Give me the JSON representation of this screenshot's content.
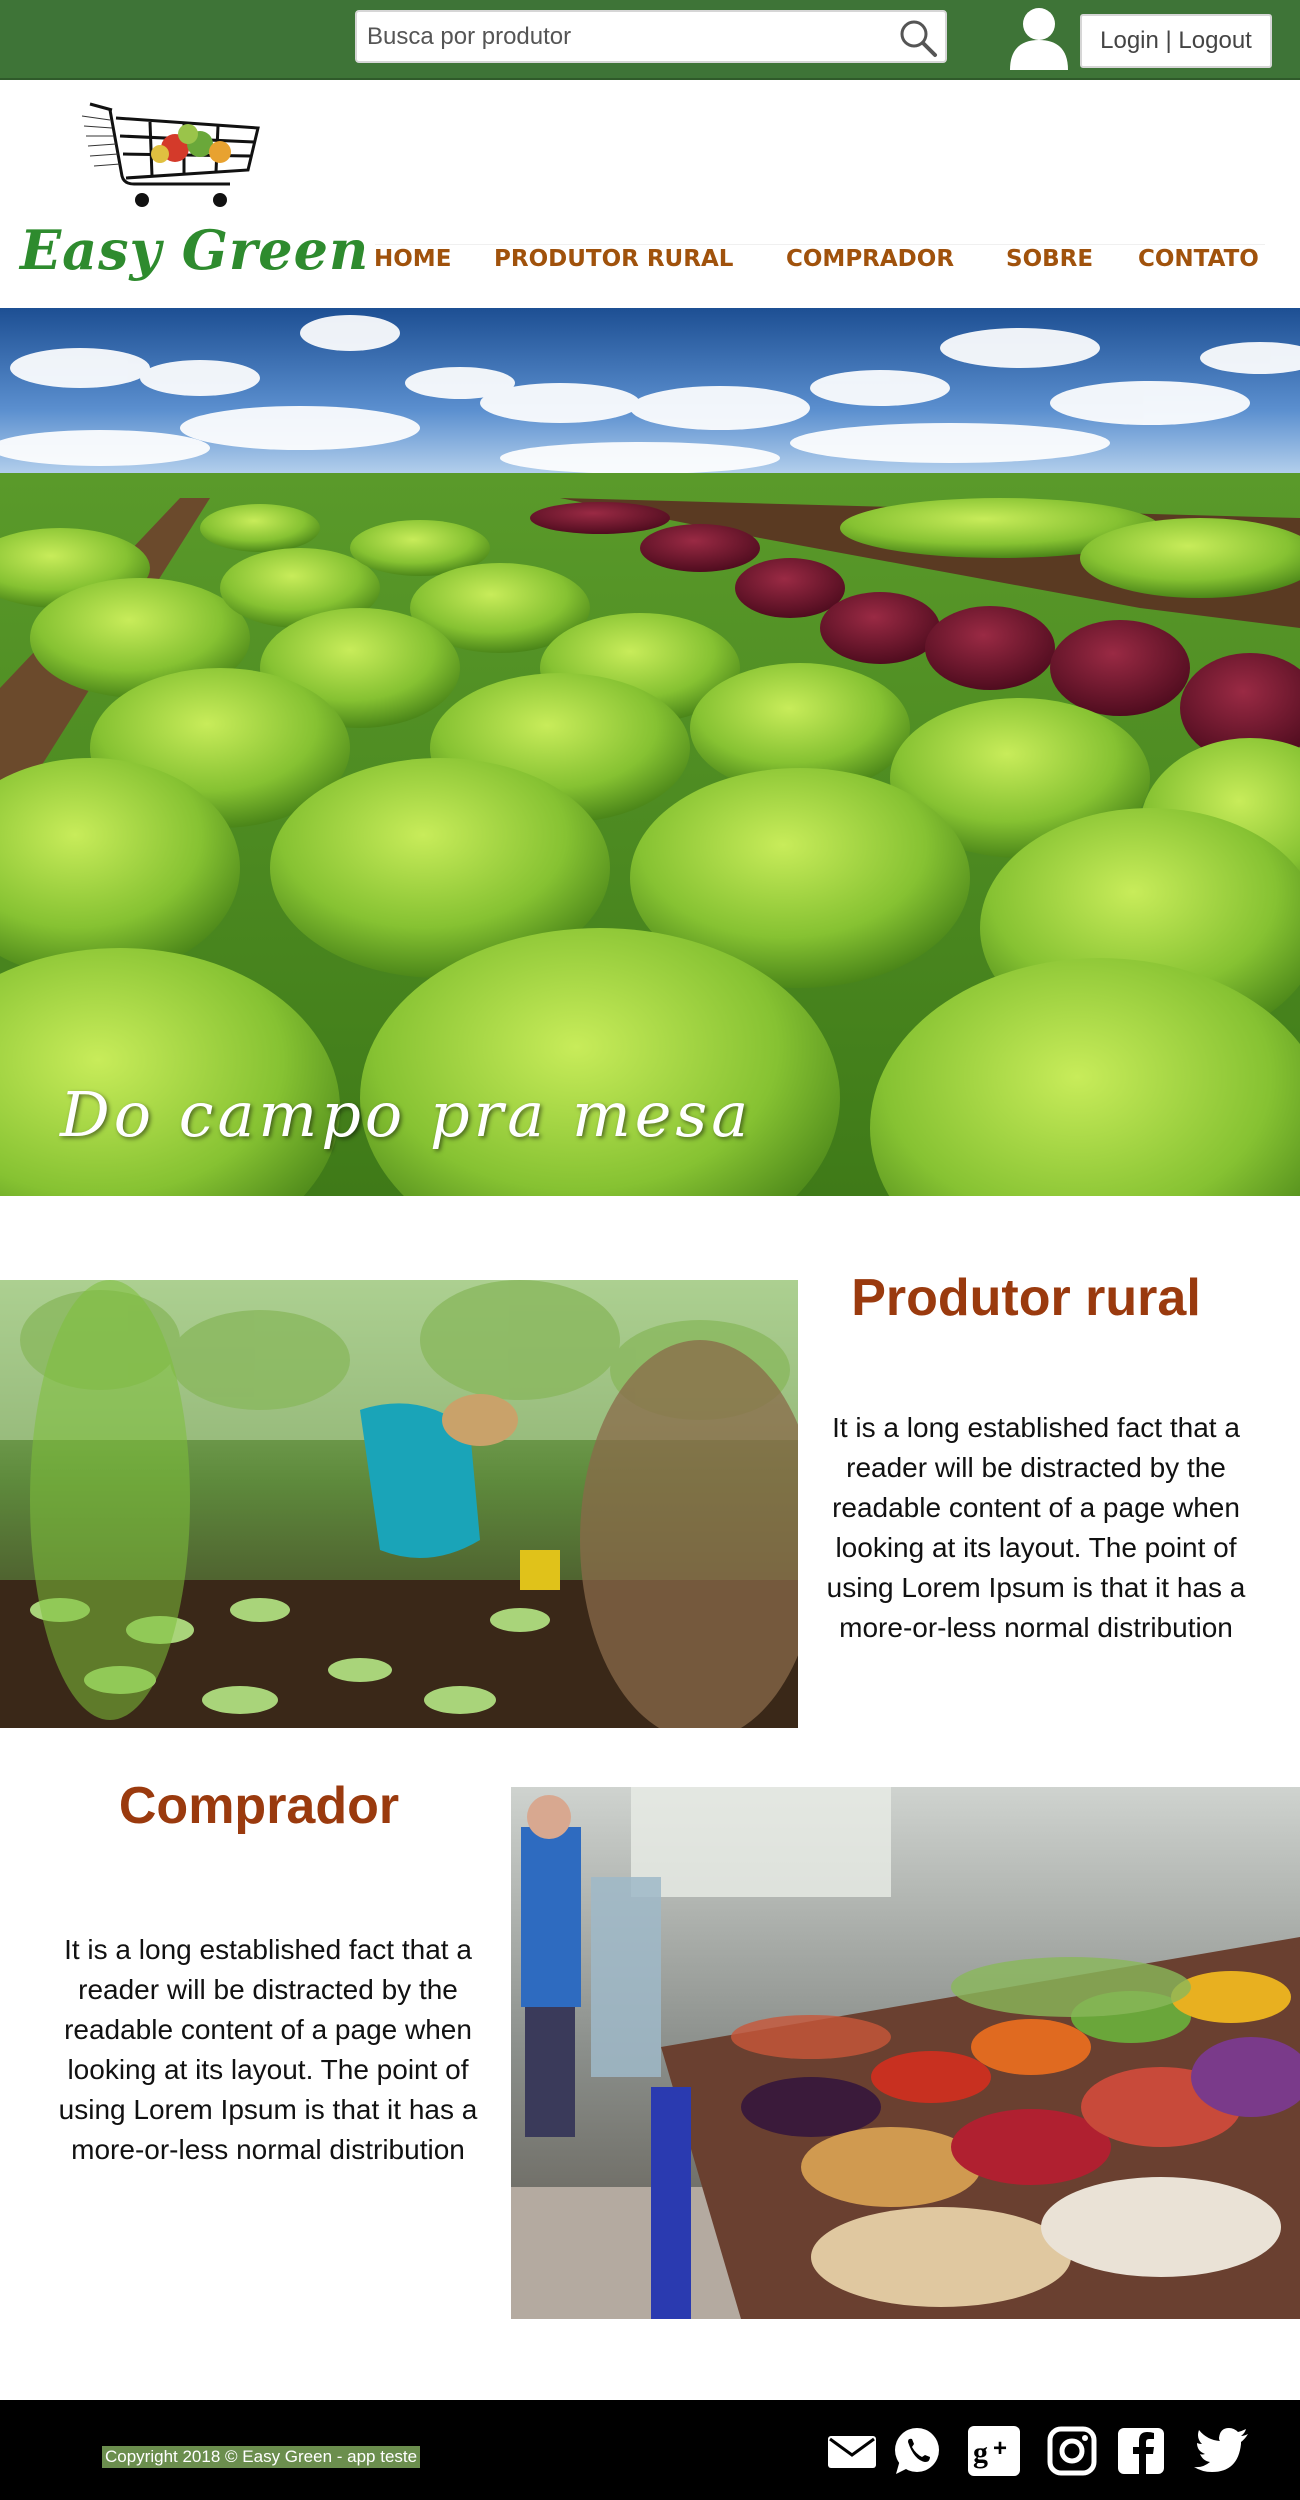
{
  "topbar": {
    "search_placeholder": "Busca por produtor",
    "login_label": "Login | Logout"
  },
  "brand": {
    "name": "Easy Green"
  },
  "nav": {
    "items": [
      "HOME",
      "PRODUTOR RURAL",
      "COMPRADOR",
      "SOBRE",
      "CONTATO"
    ]
  },
  "hero": {
    "caption": "Do campo pra mesa"
  },
  "produtor": {
    "title": "Produtor rural",
    "text": "It is a long established fact that a reader will be distracted by the readable content of a page when looking at its layout. The point of using Lorem Ipsum is that it has a more-or-less normal distribution"
  },
  "comprador": {
    "title": "Comprador",
    "text": "It is a long established fact that a reader will be distracted by the readable content of a page when looking at its layout. The point of using Lorem Ipsum is that it has a more-or-less normal distribution"
  },
  "footer": {
    "copyright": "Copyright 2018 © Easy Green - app teste",
    "social_icons": [
      "email-icon",
      "whatsapp-icon",
      "google-plus-icon",
      "instagram-icon",
      "facebook-icon",
      "twitter-icon"
    ]
  },
  "colors": {
    "topbar": "#3e7437",
    "accent_brown": "#9a3a0e",
    "nav_text": "#a0520c",
    "brand_green": "#2e8b2e"
  }
}
